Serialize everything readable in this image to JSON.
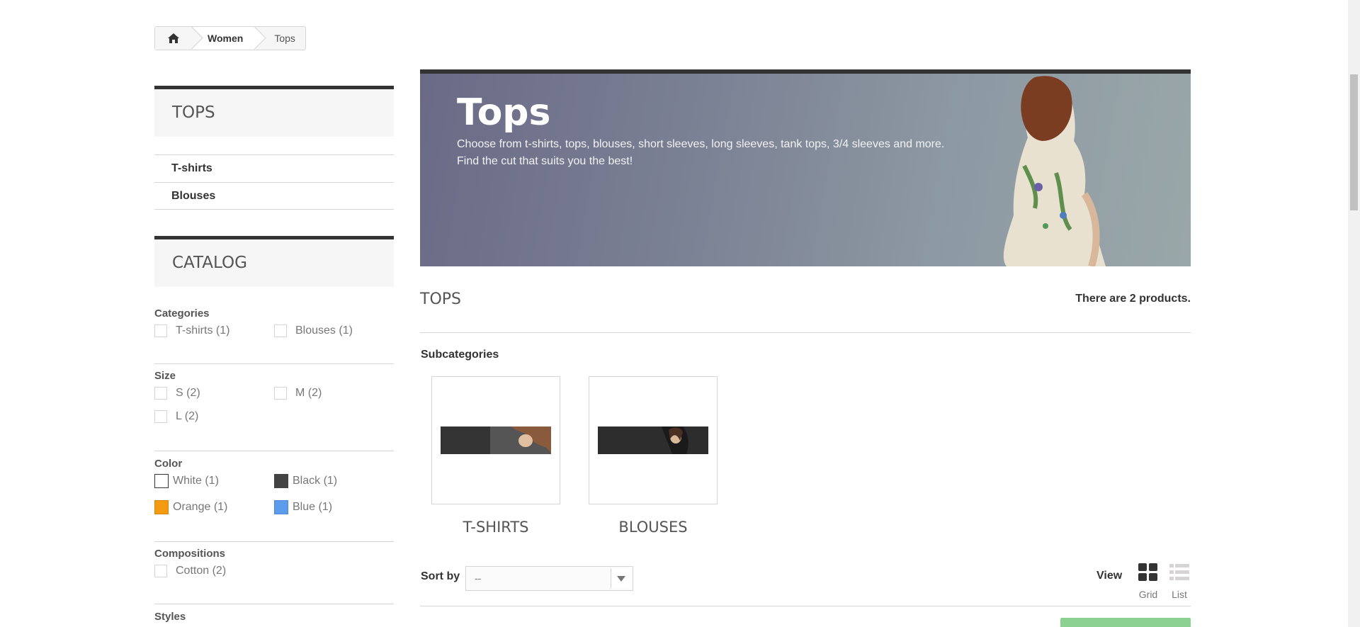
{
  "breadcrumb": {
    "home_icon": "home-icon",
    "items": [
      "Women",
      "Tops"
    ]
  },
  "sidebar": {
    "category_block": {
      "title": "TOPS",
      "items": [
        "T-shirts",
        "Blouses"
      ]
    },
    "catalog_block": {
      "title": "CATALOG",
      "filters": {
        "categories": {
          "title": "Categories",
          "options": [
            "T-shirts (1)",
            "Blouses (1)"
          ]
        },
        "size": {
          "title": "Size",
          "options": [
            "S (2)",
            "M (2)",
            "L (2)"
          ]
        },
        "color": {
          "title": "Color",
          "options": [
            {
              "label": "White (1)",
              "color": "#ffffff"
            },
            {
              "label": "Black (1)",
              "color": "#434343"
            },
            {
              "label": "Orange (1)",
              "color": "#f39c11"
            },
            {
              "label": "Blue (1)",
              "color": "#5d9cec"
            }
          ]
        },
        "compositions": {
          "title": "Compositions",
          "options": [
            "Cotton (2)"
          ]
        },
        "styles": {
          "title": "Styles"
        }
      }
    }
  },
  "main": {
    "banner": {
      "title": "Tops",
      "description_line1": "Choose from t-shirts, tops, blouses, short sleeves, long sleeves, tank tops, 3/4 sleeves and more.",
      "description_line2": "Find the cut that suits you the best!"
    },
    "heading": "TOPS",
    "product_count": "There are 2 products.",
    "subcategories": {
      "title": "Subcategories",
      "items": [
        "T-SHIRTS",
        "BLOUSES"
      ]
    },
    "sort": {
      "label": "Sort by",
      "selected": "--"
    },
    "view": {
      "label": "View",
      "grid_label": "Grid",
      "list_label": "List",
      "active": "Grid"
    }
  },
  "colors": {
    "accent_dark": "#333333",
    "border": "#d6d4d4",
    "add_button": "#8cd191"
  }
}
